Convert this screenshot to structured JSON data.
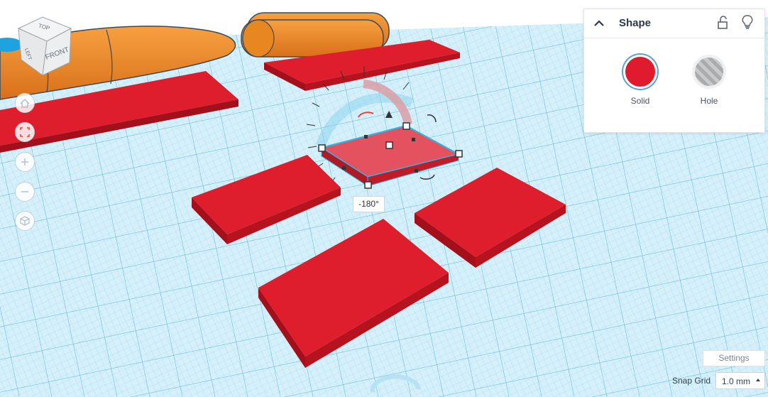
{
  "panel": {
    "title": "Shape",
    "solid_label": "Solid",
    "hole_label": "Hole",
    "solid_color": "#e01b2e",
    "icons": [
      "chevron-up-icon",
      "unlock-icon",
      "lightbulb-icon"
    ]
  },
  "view_cube": {
    "top": "TOP",
    "left": "LEFT",
    "front": "FRONT"
  },
  "nav_buttons": [
    "home-icon",
    "fit-view-icon",
    "zoom-in-icon",
    "zoom-out-icon",
    "perspective-icon"
  ],
  "rotation": {
    "angle_text": "-180°"
  },
  "settings_label": "Settings",
  "snap": {
    "label": "Snap Grid",
    "value": "1.0 mm"
  },
  "colors": {
    "workplane": "#d5f0fa",
    "grid": "#7fcbe6",
    "red_box": "#df1e2d",
    "orange_shape": "#f08a24",
    "accent_blue": "#5aa0d8"
  }
}
